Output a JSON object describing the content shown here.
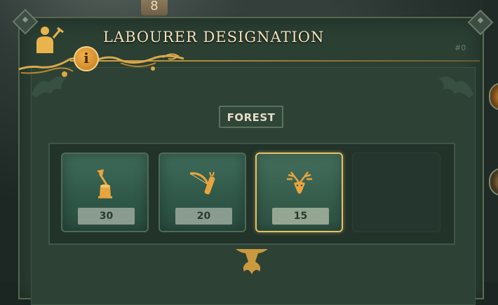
{
  "top_tab": {
    "glyph": "8"
  },
  "dialog": {
    "title": "LABOURER DESIGNATION",
    "id_tag": "#0",
    "info_icon": "i",
    "region_label": "FOREST"
  },
  "slots": [
    {
      "icon": "tree-stump-axe-icon",
      "count": "30",
      "selected": false
    },
    {
      "icon": "bow-and-arrows-icon",
      "count": "20",
      "selected": false
    },
    {
      "icon": "deer-antlers-icon",
      "count": "15",
      "selected": true
    },
    {
      "icon": "empty-slot",
      "count": "",
      "selected": false
    }
  ],
  "colors": {
    "gold": "#e4c168",
    "panel": "#2b3f33",
    "slot": "#3f6b59",
    "title_text": "#f3e2bc"
  }
}
